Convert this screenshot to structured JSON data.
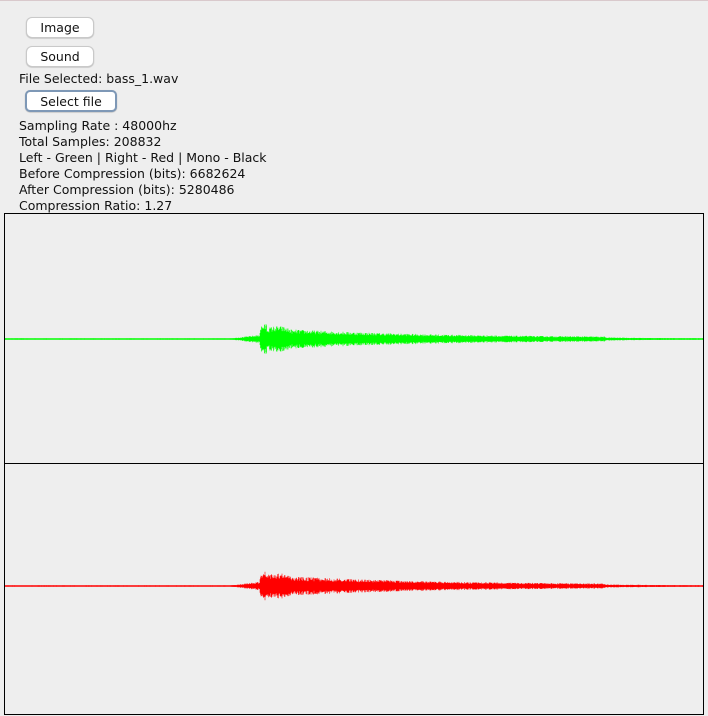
{
  "buttons": {
    "image_label": "Image",
    "sound_label": "Sound",
    "select_file_label": "Select file"
  },
  "file": {
    "selected_label": "File Selected: bass_1.wav"
  },
  "info": {
    "sampling_rate": "Sampling Rate : 48000hz",
    "total_samples": "Total Samples: 208832",
    "legend": "Left - Green | Right - Red | Mono - Black",
    "before_compression": "Before Compression (bits): 6682624",
    "after_compression": "After Compression (bits): 5280486",
    "compression_ratio": "Compression Ratio: 1.27"
  },
  "waveforms": {
    "left_color": "#00ff00",
    "right_color": "#ff0000",
    "mono_color": "#000000"
  }
}
